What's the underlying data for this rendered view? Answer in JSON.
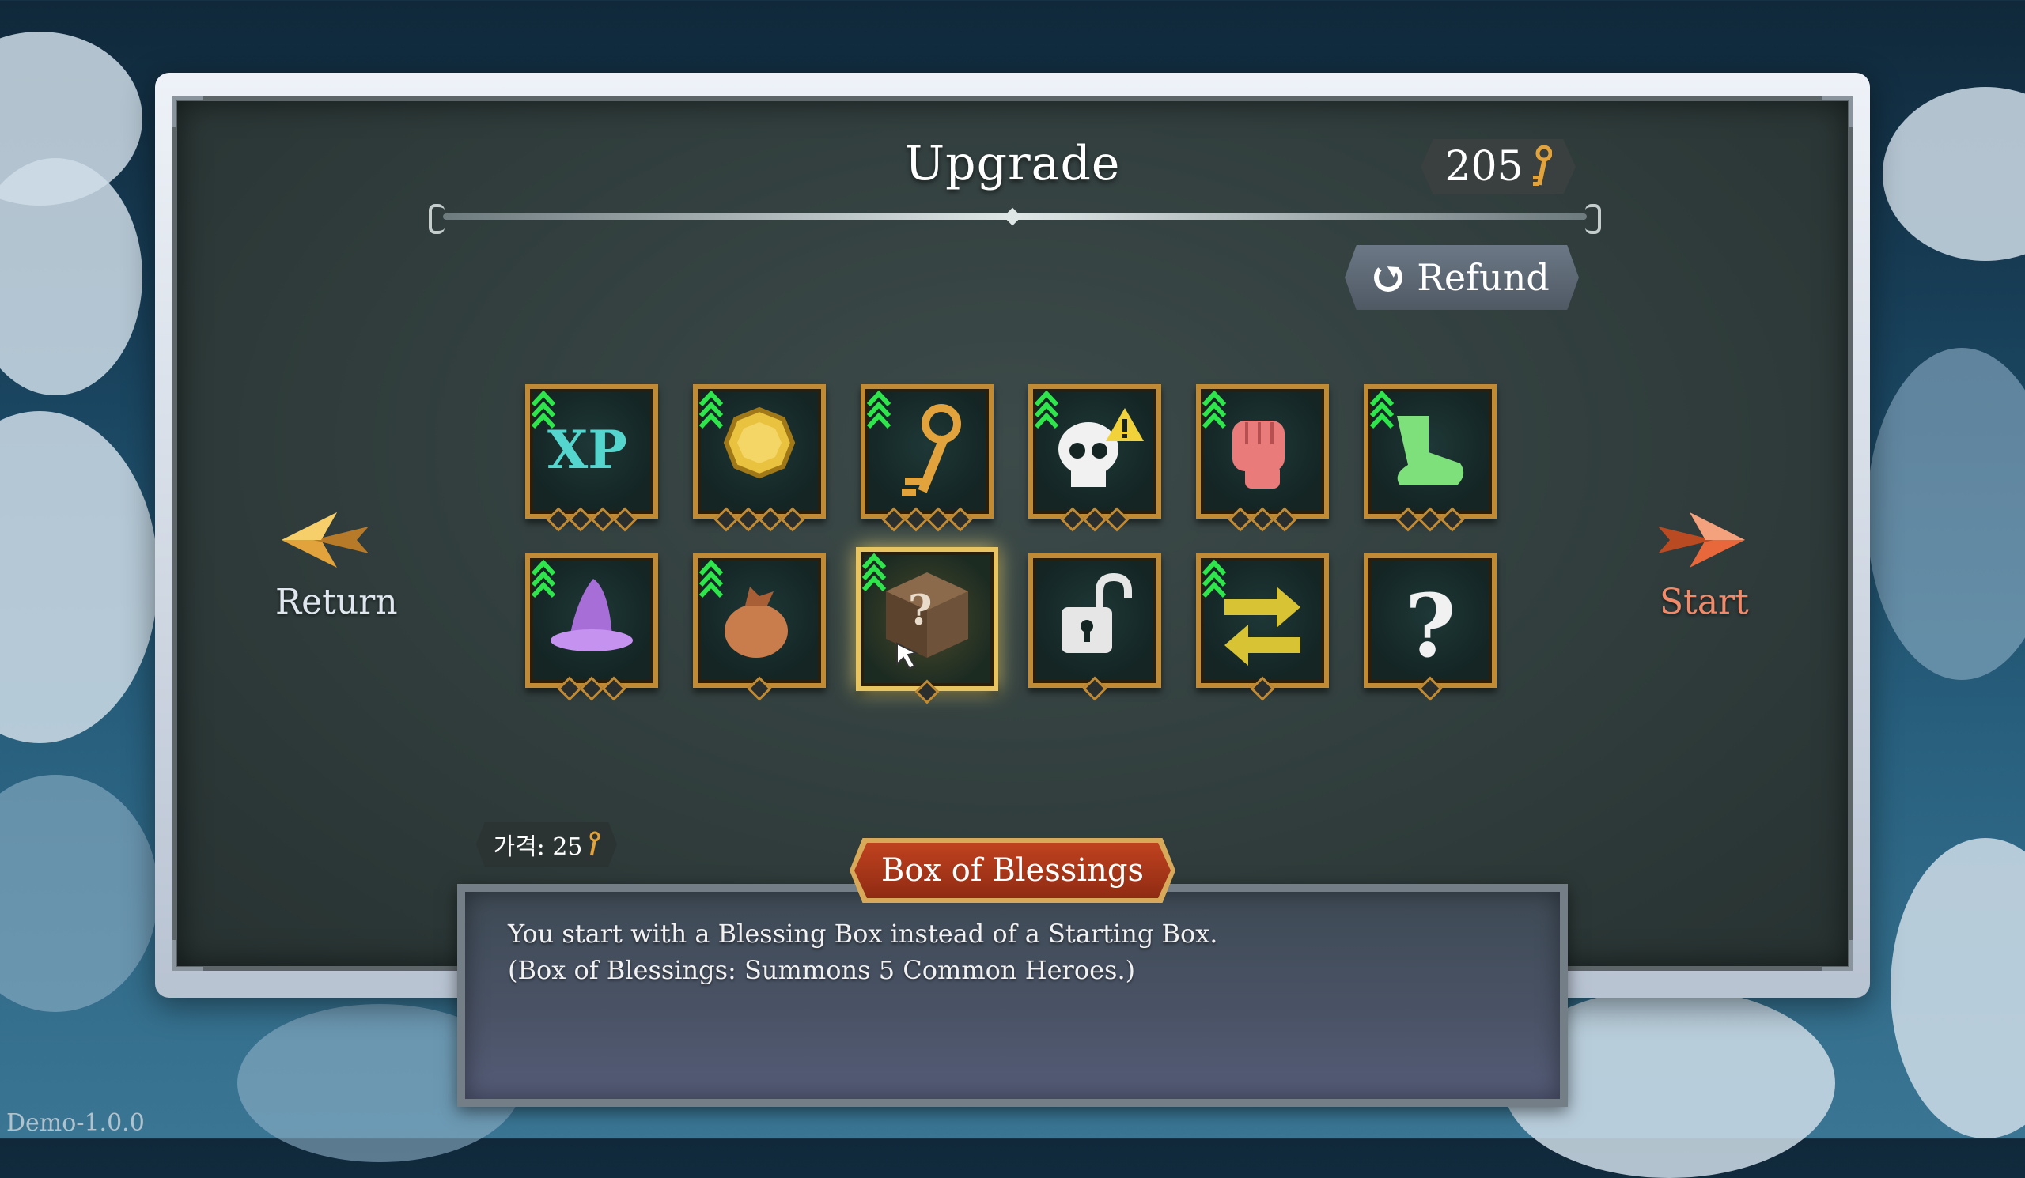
{
  "header": {
    "title": "Upgrade",
    "currency_amount": "205",
    "currency_icon": "key-icon"
  },
  "refund_button": {
    "label": "Refund",
    "icon": "refresh-icon"
  },
  "nav": {
    "return_label": "Return",
    "start_label": "Start"
  },
  "upgrades": {
    "row1": [
      {
        "name": "xp-icon",
        "glyph": "XP",
        "pips": 4
      },
      {
        "name": "gold-coin-icon",
        "pips": 4
      },
      {
        "name": "key-icon",
        "pips": 4
      },
      {
        "name": "skull-warning-icon",
        "pips": 3
      },
      {
        "name": "fist-icon",
        "pips": 3
      },
      {
        "name": "boot-icon",
        "pips": 3
      }
    ],
    "row2": [
      {
        "name": "wizard-hat-icon",
        "pips": 3
      },
      {
        "name": "money-bag-icon",
        "pips": 1
      },
      {
        "name": "mystery-box-icon",
        "glyph": "?",
        "pips": 1,
        "selected": true
      },
      {
        "name": "unlock-icon",
        "pips": 1
      },
      {
        "name": "swap-arrows-icon",
        "pips": 1
      },
      {
        "name": "question-mark-icon",
        "glyph": "?",
        "pips": 1
      }
    ]
  },
  "selected_upgrade": {
    "price_label": "가격: 25",
    "title": "Box of Blessings",
    "description_line1": "You start with a Blessing Box instead of a Starting Box.",
    "description_line2": "(Box of Blessings: Summons 5 Common Heroes.)"
  },
  "footer": {
    "version": "Demo-1.0.0"
  },
  "colors": {
    "accent_gold": "#c18a35",
    "upgrade_green": "#2ee64c",
    "header_red": "#b23a1b",
    "start_orange": "#f08a6a"
  }
}
